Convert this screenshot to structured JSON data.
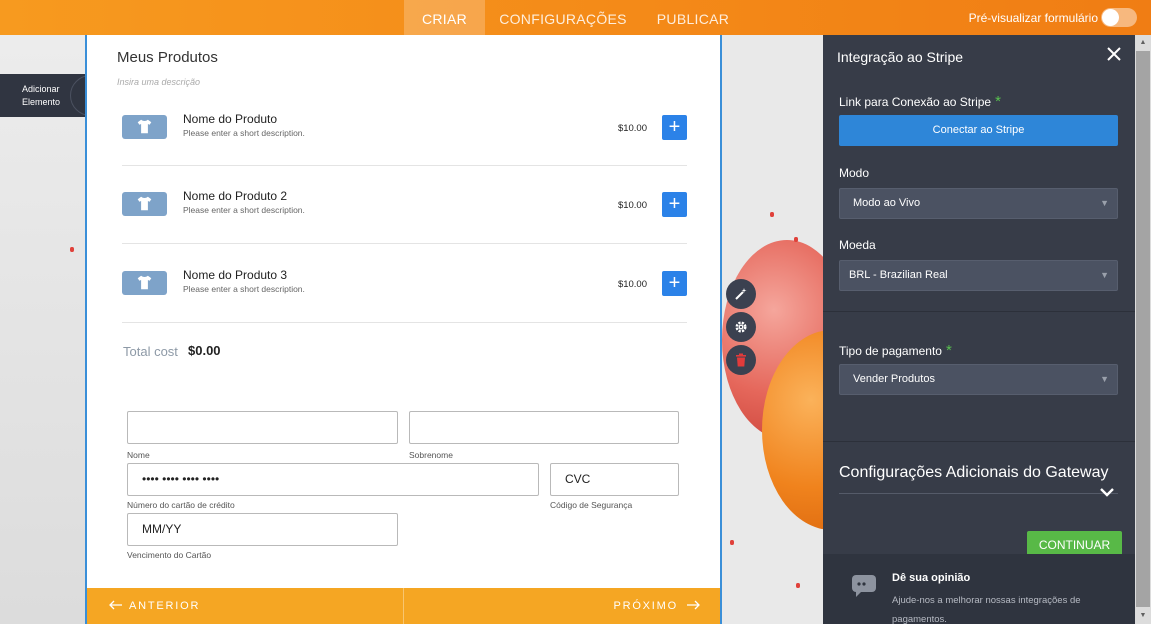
{
  "topbar": {
    "tabs": [
      {
        "label": "CRIAR",
        "active": true
      },
      {
        "label": "CONFIGURAÇÕES",
        "active": false
      },
      {
        "label": "PUBLICAR",
        "active": false
      }
    ],
    "preview_label": "Pré-visualizar formulário",
    "preview_on": false
  },
  "add_element": {
    "label_line1": "Adicionar",
    "label_line2": "Elemento"
  },
  "form": {
    "title": "Meus Produtos",
    "description_placeholder": "Insira uma descrição",
    "products": [
      {
        "name": "Nome do Produto",
        "description": "Please enter a short description.",
        "price": "$10.00"
      },
      {
        "name": "Nome do Produto 2",
        "description": "Please enter a short description.",
        "price": "$10.00"
      },
      {
        "name": "Nome do Produto 3",
        "description": "Please enter a short description.",
        "price": "$10.00"
      }
    ],
    "total_label": "Total cost",
    "total_value": "$0.00",
    "fields": {
      "first_name": {
        "value": "",
        "sublabel": "Nome"
      },
      "last_name": {
        "value": "",
        "sublabel": "Sobrenome"
      },
      "card_number": {
        "value": "•••• •••• •••• ••••",
        "sublabel": "Número do cartão de crédito"
      },
      "cvc": {
        "value": "CVC",
        "sublabel": "Código de Segurança"
      },
      "expiry": {
        "value": "MM/YY",
        "sublabel": "Vencimento do Cartão"
      }
    },
    "nav": {
      "prev": "ANTERIOR",
      "next": "PRÓXIMO"
    }
  },
  "panel": {
    "title": "Integração ao Stripe",
    "connect_label": "Link para Conexão ao Stripe",
    "connect_button": "Conectar ao Stripe",
    "mode_label": "Modo",
    "mode_value": "Modo ao Vivo",
    "currency_label": "Moeda",
    "currency_value": "BRL - Brazilian Real",
    "payment_type_label": "Tipo de pagamento",
    "payment_type_value": "Vender Produtos",
    "gateway_title": "Configurações Adicionais do Gateway",
    "continue_button": "CONTINUAR",
    "feedback_title": "Dê sua opinião",
    "feedback_text": "Ajude-nos a melhorar nossas integrações de pagamentos.",
    "required_mark": "*"
  },
  "colors": {
    "accent_orange": "#f5a623",
    "stripe_blue": "#2e86d8",
    "continue_green": "#58b947",
    "panel_bg": "#373c48"
  }
}
